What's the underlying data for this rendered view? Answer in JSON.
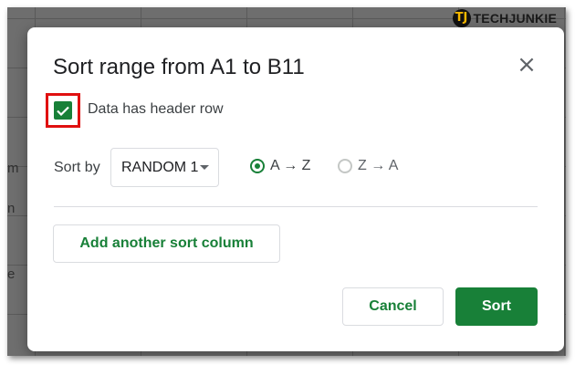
{
  "branding": {
    "logo_mark": "TJ",
    "logo_part1": "TECH",
    "logo_part2": "JUNKIE"
  },
  "background": {
    "cell_fragments": [
      "m",
      "n",
      "e"
    ]
  },
  "dialog": {
    "title": "Sort range from A1 to B11",
    "close_icon": "close-icon",
    "header_checkbox": {
      "label": "Data has header row",
      "checked": true,
      "highlight_color": "#e01010"
    },
    "sort_by_label": "Sort by",
    "column_select": {
      "selected": "RANDOM 1"
    },
    "order_options": [
      {
        "label": "A → Z",
        "selected": true
      },
      {
        "label": "Z → A",
        "selected": false
      }
    ],
    "add_sort_column_label": "Add another sort column",
    "cancel_label": "Cancel",
    "sort_label": "Sort"
  },
  "colors": {
    "accent": "#188038",
    "text": "#202124",
    "border": "#dadce0"
  }
}
